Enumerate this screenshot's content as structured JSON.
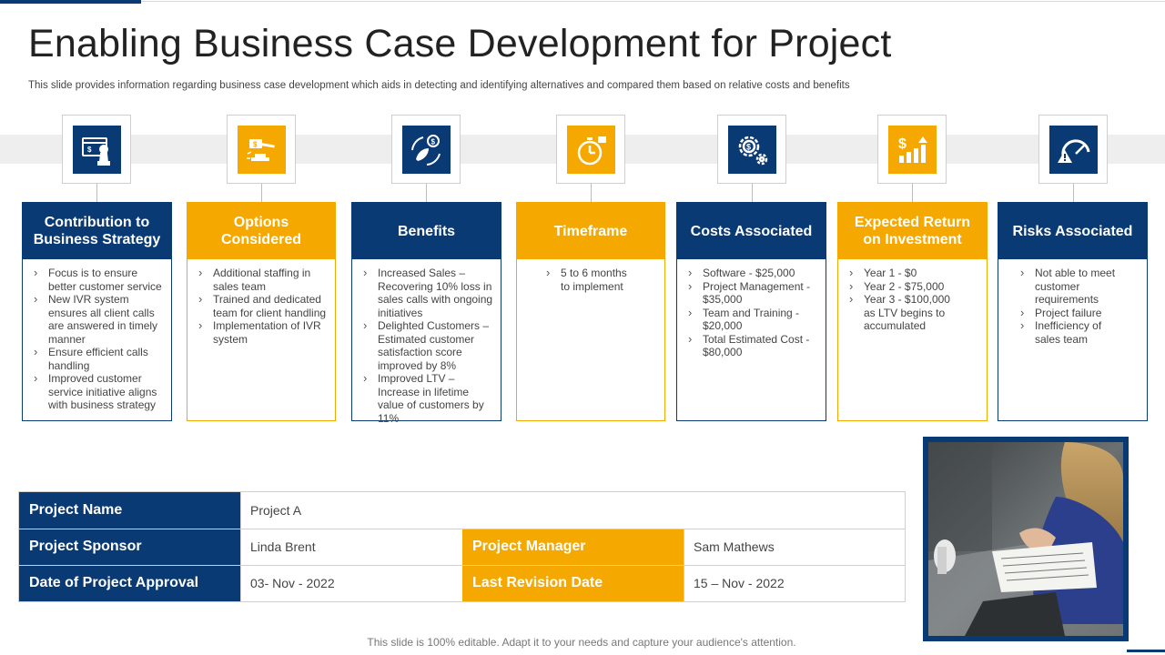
{
  "header": {
    "title": "Enabling Business Case Development for Project",
    "subtitle": "This slide provides information regarding business case development which aids in detecting and identifying alternatives and compared them based on relative costs and benefits"
  },
  "colors": {
    "navy": "#0a3a73",
    "amber": "#f5a800"
  },
  "cards": [
    {
      "icon": "strategy-chess-icon",
      "title": "Contribution to Business Strategy",
      "color": "navy",
      "items": [
        "Focus is to ensure better customer service",
        "New IVR system ensures all client calls are answered in timely manner",
        "Ensure efficient calls handling",
        "Improved customer service initiative aligns with business strategy"
      ]
    },
    {
      "icon": "gavel-icon",
      "title": "Options Considered",
      "color": "amber",
      "items": [
        "Additional staffing in sales team",
        "Trained and dedicated team for client handling",
        "Implementation of IVR system"
      ]
    },
    {
      "icon": "rocket-dollar-icon",
      "title": "Benefits",
      "color": "navy",
      "items": [
        "Increased Sales – Recovering 10% loss in sales calls with ongoing initiatives",
        "Delighted Customers – Estimated customer satisfaction score improved by 8%",
        "Improved LTV – Increase in lifetime value of customers by 11%"
      ]
    },
    {
      "icon": "stopwatch-icon",
      "title": "Timeframe",
      "color": "amber",
      "items": [
        "5 to 6 months to implement"
      ]
    },
    {
      "icon": "gear-dollar-icon",
      "title": "Costs Associated",
      "color": "navy",
      "items": [
        "Software - $25,000",
        "Project Management - $35,000",
        "Team and Training - $20,000",
        "Total Estimated Cost - $80,000"
      ]
    },
    {
      "icon": "growth-chart-icon",
      "title": "Expected Return on Investment",
      "color": "amber",
      "items": [
        "Year 1 - $0",
        "Year 2 - $75,000",
        "Year 3 - $100,000 as LTV begins to accumulated"
      ]
    },
    {
      "icon": "risk-gauge-icon",
      "title": "Risks Associated",
      "color": "navy",
      "items": [
        "Not able to meet customer requirements",
        "Project failure",
        "Inefficiency of sales team"
      ]
    }
  ],
  "project_table": {
    "project_name_label": "Project Name",
    "project_name_value": "Project A",
    "sponsor_label": "Project Sponsor",
    "sponsor_value": "Linda Brent",
    "manager_label": "Project Manager",
    "manager_value": "Sam Mathews",
    "approval_label": "Date of Project Approval",
    "approval_value": "03- Nov - 2022",
    "revision_label": "Last Revision Date",
    "revision_value": "15 – Nov - 2022"
  },
  "footer": {
    "note": "This slide is 100% editable. Adapt it to your needs and capture your audience's attention."
  }
}
